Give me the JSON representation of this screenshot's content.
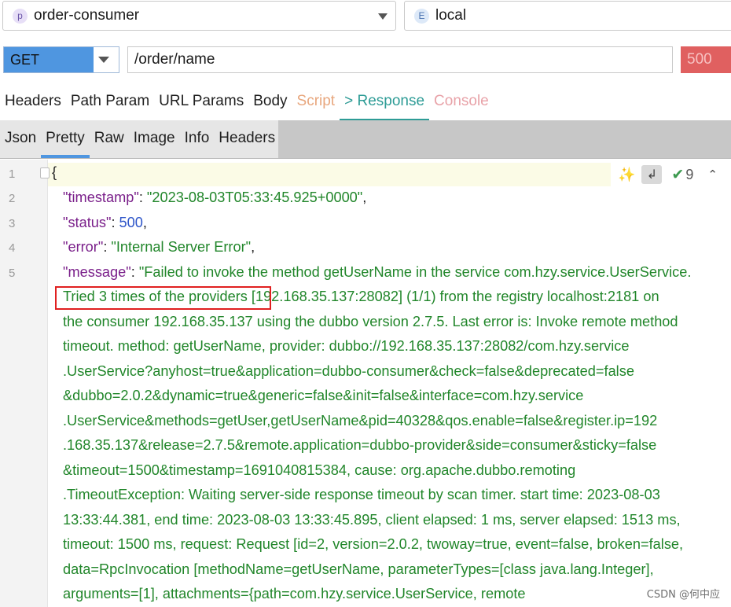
{
  "project": {
    "badge": "p",
    "value": "order-consumer"
  },
  "environment": {
    "badge": "E",
    "value": "local"
  },
  "request": {
    "method": "GET",
    "url": "/order/name",
    "status": "500"
  },
  "request_tabs": [
    {
      "label": "Headers",
      "state": "normal"
    },
    {
      "label": "Path Param",
      "state": "normal"
    },
    {
      "label": "URL Params",
      "state": "normal"
    },
    {
      "label": "Body",
      "state": "normal"
    },
    {
      "label": "Script",
      "state": "muted"
    },
    {
      "label": "> Response",
      "state": "active"
    },
    {
      "label": "Console",
      "state": "muted"
    }
  ],
  "response_tabs": [
    {
      "label": "Json",
      "state": "normal"
    },
    {
      "label": "Pretty",
      "state": "active"
    },
    {
      "label": "Raw",
      "state": "normal"
    },
    {
      "label": "Image",
      "state": "normal"
    },
    {
      "label": "Info",
      "state": "normal"
    },
    {
      "label": "Headers",
      "state": "normal"
    }
  ],
  "editor": {
    "line_numbers": [
      "1",
      "2",
      "3",
      "4",
      "5"
    ],
    "issue_count": "9",
    "icons": [
      "magic-wand-icon",
      "soft-wrap-icon",
      "check-icon",
      "chevron-up-icon"
    ],
    "open_brace": "{",
    "fields": {
      "timestamp_key": "\"timestamp\"",
      "timestamp_value": "\"2023-08-03T05:33:45.925+0000\"",
      "status_key": "\"status\"",
      "status_value": "500",
      "error_key": "\"error\"",
      "error_value": "\"Internal Server Error\"",
      "message_key": "\"message\"",
      "message_first": "\"Failed to invoke the method getUserName in the service com.hzy.service.UserService."
    },
    "message_lines": [
      "Tried 3 times of the providers [192.168.35.137:28082] (1/1) from the registry localhost:2181 on",
      "the consumer 192.168.35.137 using the dubbo version 2.7.5. Last error is: Invoke remote method",
      "timeout. method: getUserName, provider: dubbo://192.168.35.137:28082/com.hzy.service",
      ".UserService?anyhost=true&application=dubbo-consumer&check=false&deprecated=false",
      "&dubbo=2.0.2&dynamic=true&generic=false&init=false&interface=com.hzy.service",
      ".UserService&methods=getUser,getUserName&pid=40328&qos.enable=false&register.ip=192",
      ".168.35.137&release=2.7.5&remote.application=dubbo-provider&side=consumer&sticky=false",
      "&timeout=1500&timestamp=1691040815384, cause: org.apache.dubbo.remoting",
      ".TimeoutException: Waiting server-side response timeout by scan timer. start time: 2023-08-03",
      "13:33:44.381, end time: 2023-08-03 13:33:45.895, client elapsed: 1 ms, server elapsed: 1513 ms,",
      "timeout: 1500 ms, request: Request [id=2, version=2.0.2, twoway=true, event=false, broken=false,",
      "data=RpcInvocation [methodName=getUserName, parameterTypes=[class java.lang.Integer],",
      "arguments=[1], attachments={path=com.hzy.service.UserService, remote"
    ],
    "highlighted_text": "Tried 3 times of the providers"
  },
  "watermark": "CSDN @何中应",
  "colors": {
    "accent_blue": "#4f96e0",
    "active_tab_teal": "#2e9c96",
    "status_red": "#e06060",
    "json_key": "#7a1f8a",
    "json_string": "#21862a",
    "json_number": "#2f56c9",
    "annotation_red": "#e02020"
  }
}
